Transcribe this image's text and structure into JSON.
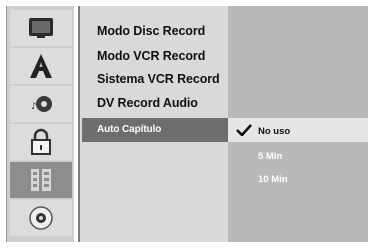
{
  "sidebar": {
    "icons": [
      {
        "name": "monitor-icon"
      },
      {
        "name": "letter-a-icon"
      },
      {
        "name": "audio-disc-icon"
      },
      {
        "name": "padlock-icon"
      },
      {
        "name": "record-film-icon",
        "active": true
      },
      {
        "name": "disc-icon"
      }
    ]
  },
  "menu": {
    "items": [
      {
        "label": "Modo Disc Record"
      },
      {
        "label": "Modo VCR Record"
      },
      {
        "label": "Sistema VCR Record"
      },
      {
        "label": "DV Record Audio"
      },
      {
        "label": "Auto Capítulo",
        "selected": true
      }
    ]
  },
  "options": {
    "items": [
      {
        "label": "No uso",
        "checked": true
      },
      {
        "label": "5 Min"
      },
      {
        "label": "10 Min"
      }
    ]
  },
  "colors": {
    "icon_column": "#cfcfcf",
    "menu_panel": "#d9d9d9",
    "options_panel": "#b9b9b9",
    "selected_bar": "#6d6d6d",
    "option_highlight": "#e6e6e6"
  }
}
